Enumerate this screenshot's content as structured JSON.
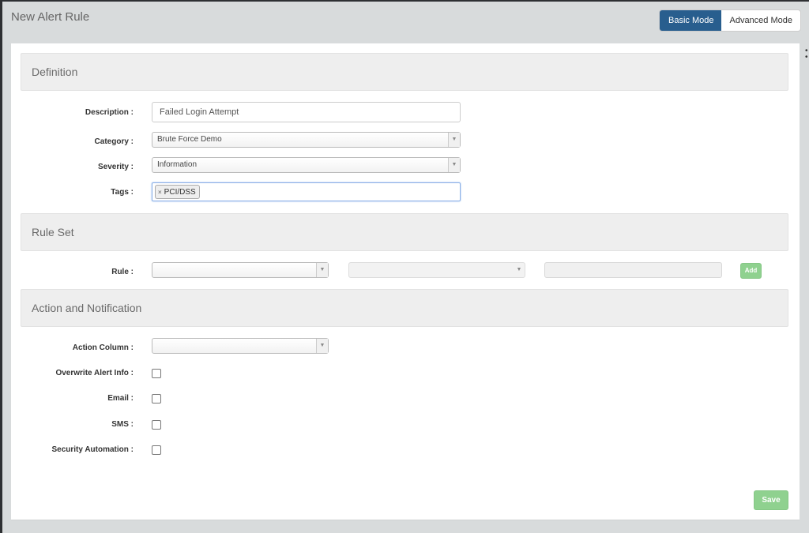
{
  "page": {
    "title": "New Alert Rule",
    "modes": {
      "basic": "Basic Mode",
      "advanced": "Advanced Mode",
      "active": "Basic Mode"
    }
  },
  "sections": {
    "definition": {
      "title": "Definition",
      "fields": {
        "description": {
          "label": "Description :",
          "value": "Failed Login Attempt"
        },
        "category": {
          "label": "Category :",
          "value": "Brute Force Demo"
        },
        "severity": {
          "label": "Severity :",
          "value": "Information"
        },
        "tags": {
          "label": "Tags :",
          "values": [
            "PCI/DSS"
          ],
          "remove_glyph": "×"
        }
      }
    },
    "rule_set": {
      "title": "Rule Set",
      "rule_label": "Rule :",
      "rule_field": "",
      "operator_field": "",
      "value_field": "",
      "add_label": "Add"
    },
    "action": {
      "title": "Action and Notification",
      "action_column": {
        "label": "Action Column :",
        "value": ""
      },
      "checkboxes": [
        {
          "label": "Overwrite Alert Info :",
          "checked": false
        },
        {
          "label": "Email :",
          "checked": false
        },
        {
          "label": "SMS :",
          "checked": false
        },
        {
          "label": "Security Automation :",
          "checked": false
        }
      ]
    }
  },
  "footer": {
    "save_label": "Save"
  },
  "icons": {
    "dropdown": "▼",
    "side_menu": "⋮"
  },
  "colors": {
    "primary": "#285e8e",
    "success_disabled": "#8fd18f",
    "focus_border": "#89aee6"
  }
}
